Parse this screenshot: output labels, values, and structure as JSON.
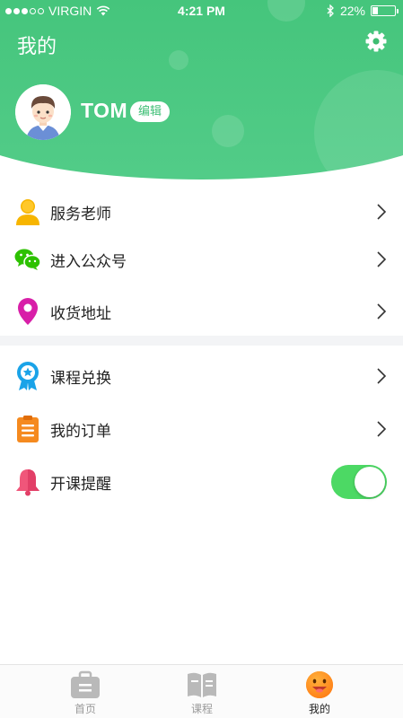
{
  "status_bar": {
    "carrier": "VIRGIN",
    "time": "4:21 PM",
    "battery": "22%",
    "battery_level": 0.22
  },
  "header": {
    "title": "我的",
    "user_name": "TOM",
    "edit_label": "编辑",
    "accent_color": "#3ebd72"
  },
  "menu": {
    "group1": [
      {
        "label": "服务老师",
        "icon": "person-icon"
      },
      {
        "label": "进入公众号",
        "icon": "wechat-icon"
      },
      {
        "label": "收货地址",
        "icon": "location-pin-icon"
      }
    ],
    "group2": [
      {
        "label": "课程兑换",
        "icon": "badge-icon"
      },
      {
        "label": "我的订单",
        "icon": "clipboard-icon"
      },
      {
        "label": "开课提醒",
        "icon": "bell-icon",
        "toggle_on": true
      }
    ]
  },
  "tabbar": [
    {
      "label": "首页",
      "icon": "briefcase-icon",
      "active": false
    },
    {
      "label": "课程",
      "icon": "book-icon",
      "active": false
    },
    {
      "label": "我的",
      "icon": "smiley-icon",
      "active": true
    }
  ]
}
